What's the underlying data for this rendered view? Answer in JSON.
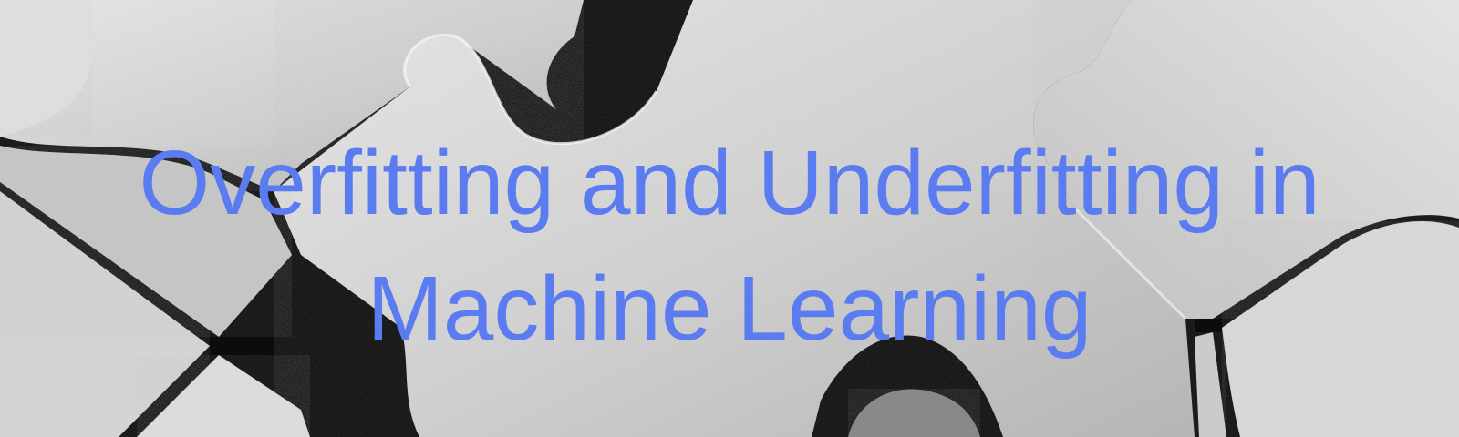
{
  "banner": {
    "title_line_1": "Overfitting and Underfitting in",
    "title_line_2": "Machine Learning",
    "title_color": "#5b7cf0",
    "background": "grayscale-jigsaw-puzzle-pieces-photo"
  },
  "colors": {
    "paper_light": "#e4e4e4",
    "paper_mid": "#c8c8c8",
    "shadow": "#050505",
    "title": "#5b7cf0"
  }
}
